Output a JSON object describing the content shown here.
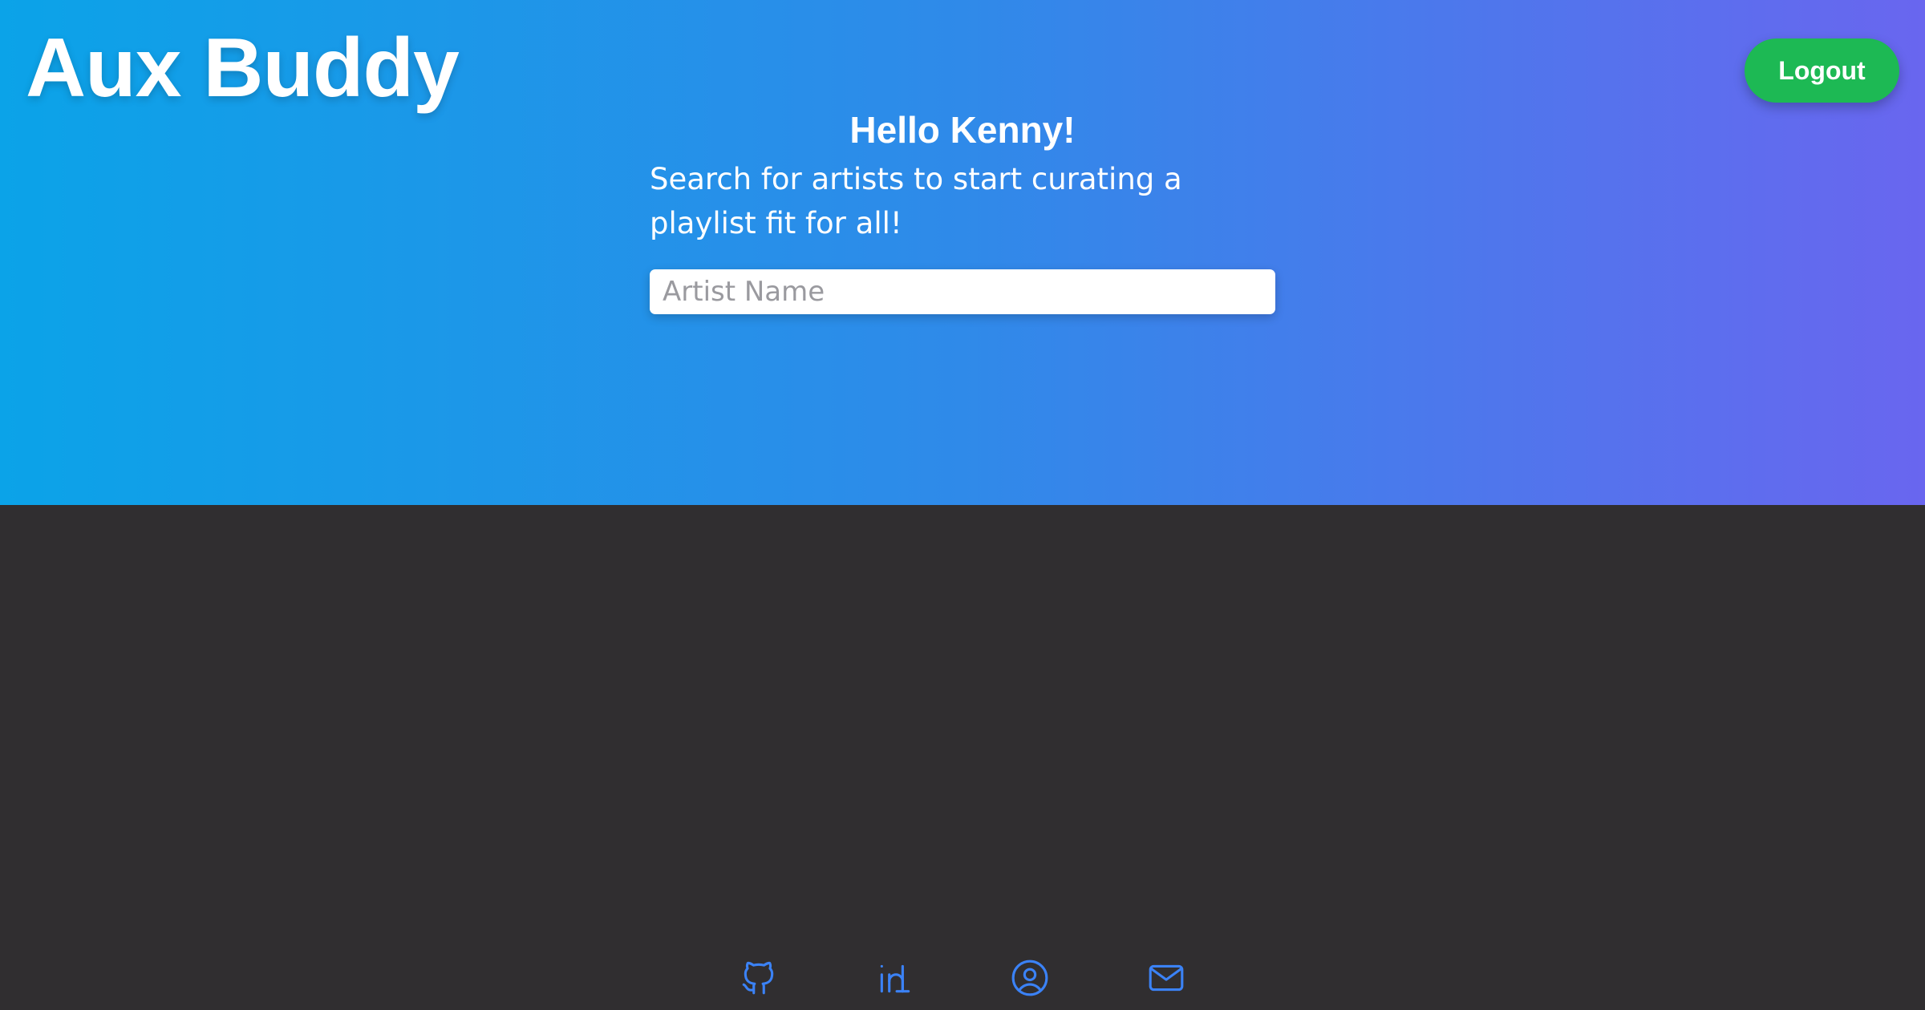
{
  "header": {
    "title": "Aux Buddy",
    "logout_label": "Logout"
  },
  "main": {
    "greeting": "Hello Kenny!",
    "subtitle": "Search for artists to start curating a playlist fit for all!",
    "search": {
      "placeholder": "Artist Name",
      "value": ""
    }
  },
  "footer": {
    "links": [
      {
        "icon": "github-icon"
      },
      {
        "icon": "linkedin-icon"
      },
      {
        "icon": "user-circle-icon"
      },
      {
        "icon": "mail-icon"
      }
    ]
  },
  "colors": {
    "gradient_start": "#0ba3e8",
    "gradient_end": "#6966ef",
    "footer_background": "#302e30",
    "logout_button": "#1db954",
    "icon_color": "#3b82f6"
  }
}
